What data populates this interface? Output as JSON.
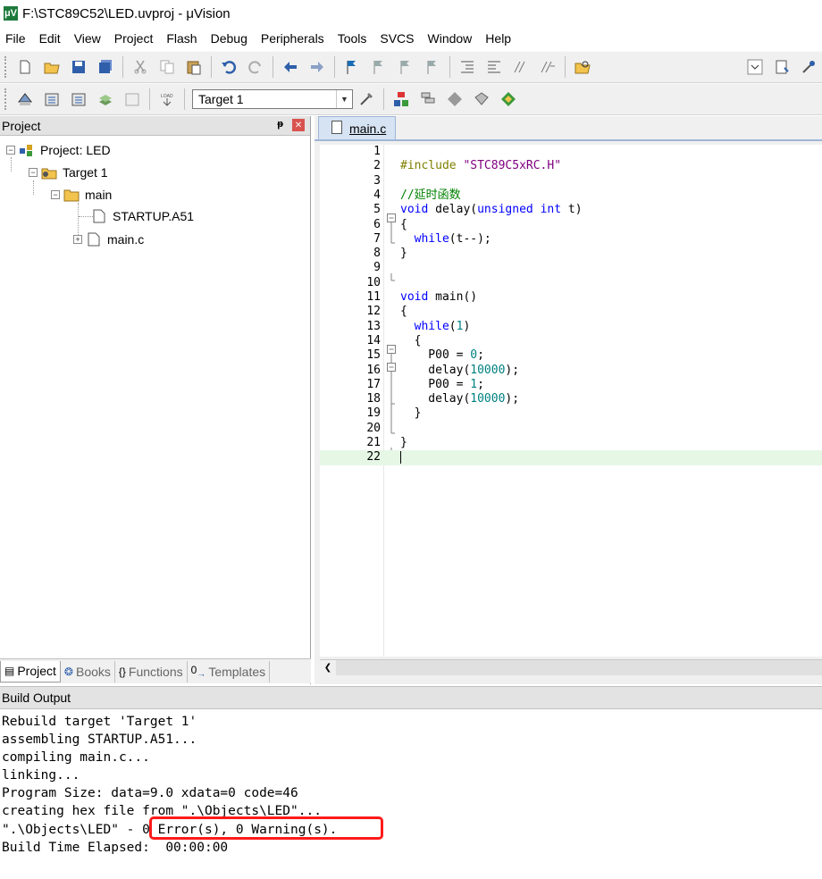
{
  "window": {
    "title": "F:\\STC89C52\\LED.uvproj - μVision"
  },
  "menu": [
    "File",
    "Edit",
    "View",
    "Project",
    "Flash",
    "Debug",
    "Peripherals",
    "Tools",
    "SVCS",
    "Window",
    "Help"
  ],
  "toolbar2": {
    "target": "Target 1"
  },
  "project_panel": {
    "title": "Project",
    "tree": {
      "project": "Project: LED",
      "target": "Target 1",
      "group": "main",
      "file1": "STARTUP.A51",
      "file2": "main.c"
    },
    "tabs": [
      "Project",
      "Books",
      "Functions",
      "Templates"
    ]
  },
  "editor": {
    "tab": "main.c",
    "lines": [
      {
        "n": "1",
        "code": ""
      },
      {
        "n": "2",
        "code": "#include \"STC89C5xRC.H\""
      },
      {
        "n": "3",
        "code": ""
      },
      {
        "n": "4",
        "code": "//延时函数"
      },
      {
        "n": "5",
        "code": "void delay(unsigned int t)"
      },
      {
        "n": "6",
        "code": "{"
      },
      {
        "n": "7",
        "code": "  while(t--);"
      },
      {
        "n": "8",
        "code": "}"
      },
      {
        "n": "9",
        "code": ""
      },
      {
        "n": "10",
        "code": ""
      },
      {
        "n": "11",
        "code": "void main()"
      },
      {
        "n": "12",
        "code": "{"
      },
      {
        "n": "13",
        "code": "  while(1)"
      },
      {
        "n": "14",
        "code": "  {"
      },
      {
        "n": "15",
        "code": "    P00 = 0;"
      },
      {
        "n": "16",
        "code": "    delay(10000);"
      },
      {
        "n": "17",
        "code": "    P00 = 1;"
      },
      {
        "n": "18",
        "code": "    delay(10000);"
      },
      {
        "n": "19",
        "code": "  }"
      },
      {
        "n": "20",
        "code": ""
      },
      {
        "n": "21",
        "code": "}"
      },
      {
        "n": "22",
        "code": ""
      }
    ]
  },
  "build_output": {
    "title": "Build Output",
    "lines": [
      "Rebuild target 'Target 1'",
      "assembling STARTUP.A51...",
      "compiling main.c...",
      "linking...",
      "Program Size: data=9.0 xdata=0 code=46",
      "creating hex file from \".\\Objects\\LED\"...",
      "\".\\Objects\\LED\" - 0 Error(s), 0 Warning(s).",
      "Build Time Elapsed:  00:00:00"
    ]
  }
}
